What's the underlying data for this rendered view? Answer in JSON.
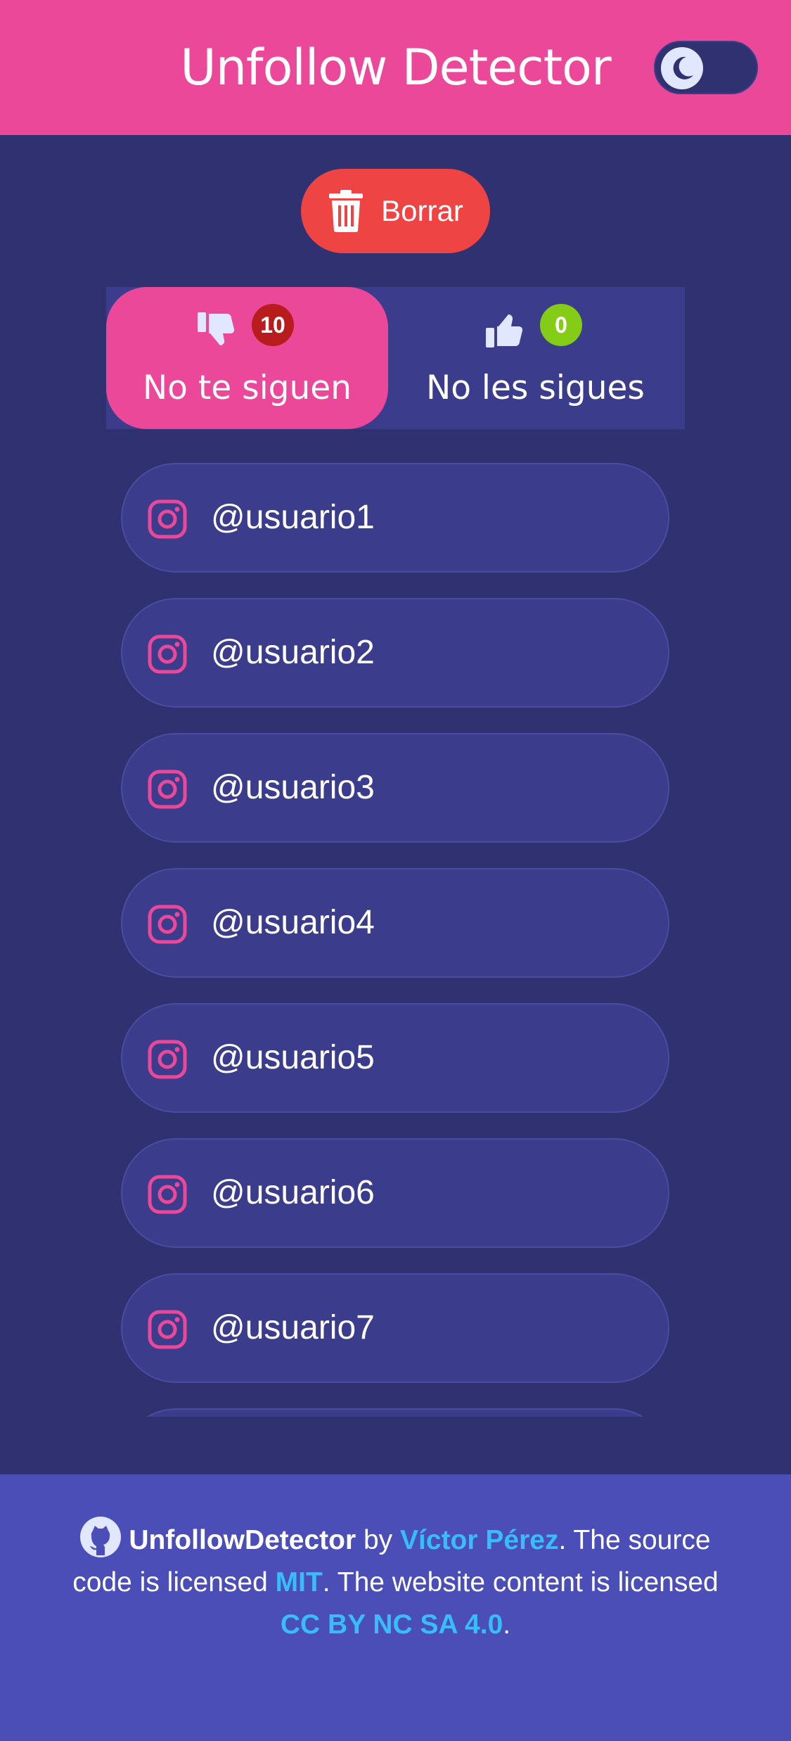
{
  "header": {
    "title": "Unfollow Detector",
    "toggle_icon": "moon-icon"
  },
  "actions": {
    "delete_label": "Borrar"
  },
  "tabs": [
    {
      "label": "No te siguen",
      "count": "10",
      "icon": "thumbs-down-icon",
      "badge_color": "#b91c1c",
      "active": true
    },
    {
      "label": "No les sigues",
      "count": "0",
      "icon": "thumbs-up-icon",
      "badge_color": "#84cc16",
      "active": false
    }
  ],
  "users": [
    "@usuario1",
    "@usuario2",
    "@usuario3",
    "@usuario4",
    "@usuario5",
    "@usuario6",
    "@usuario7"
  ],
  "footer": {
    "brand": "UnfollowDetector",
    "by": " by ",
    "author": "Víctor Pérez",
    "source_text": ". The source",
    "licensed_text": "code is licensed ",
    "mit": "MIT",
    "content_text": ". The website content is licensed",
    "cc": "CC BY NC SA 4.0",
    "period": "."
  },
  "colors": {
    "primary": "#ec4899",
    "background": "#2f3170",
    "card": "#3b3d8c",
    "danger": "#ef4444",
    "link": "#38bdf8",
    "footer": "#4a4eb6"
  }
}
